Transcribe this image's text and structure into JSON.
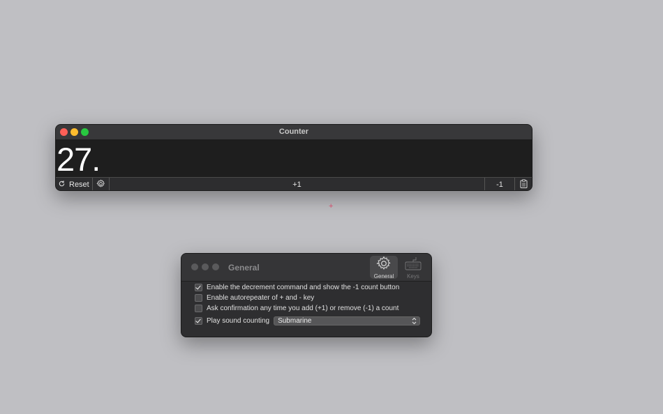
{
  "counter_window": {
    "title": "Counter",
    "count_value": "27.",
    "toolbar": {
      "reset_label": "Reset",
      "increment_label": "+1",
      "decrement_label": "-1"
    }
  },
  "cursor_glyph": "+",
  "preferences_window": {
    "title": "General",
    "tabs": [
      {
        "label": "General",
        "icon": "gear-icon",
        "selected": true
      },
      {
        "label": "Keys",
        "icon": "keyboard-icon",
        "selected": false
      }
    ],
    "options": [
      {
        "label": "Enable the decrement command and show the -1 count button",
        "checked": true
      },
      {
        "label": "Enable autorepeater of + and - key",
        "checked": false
      },
      {
        "label": "Ask confirmation any time you add (+1) or remove (-1) a count",
        "checked": false
      },
      {
        "label": "Play sound counting",
        "checked": true
      }
    ],
    "sound_select": {
      "value": "Submarine"
    }
  },
  "colors": {
    "close": "#fe5f57",
    "minimize": "#febc2e",
    "maximize": "#28c840",
    "desktop": "#bfbfc3"
  }
}
